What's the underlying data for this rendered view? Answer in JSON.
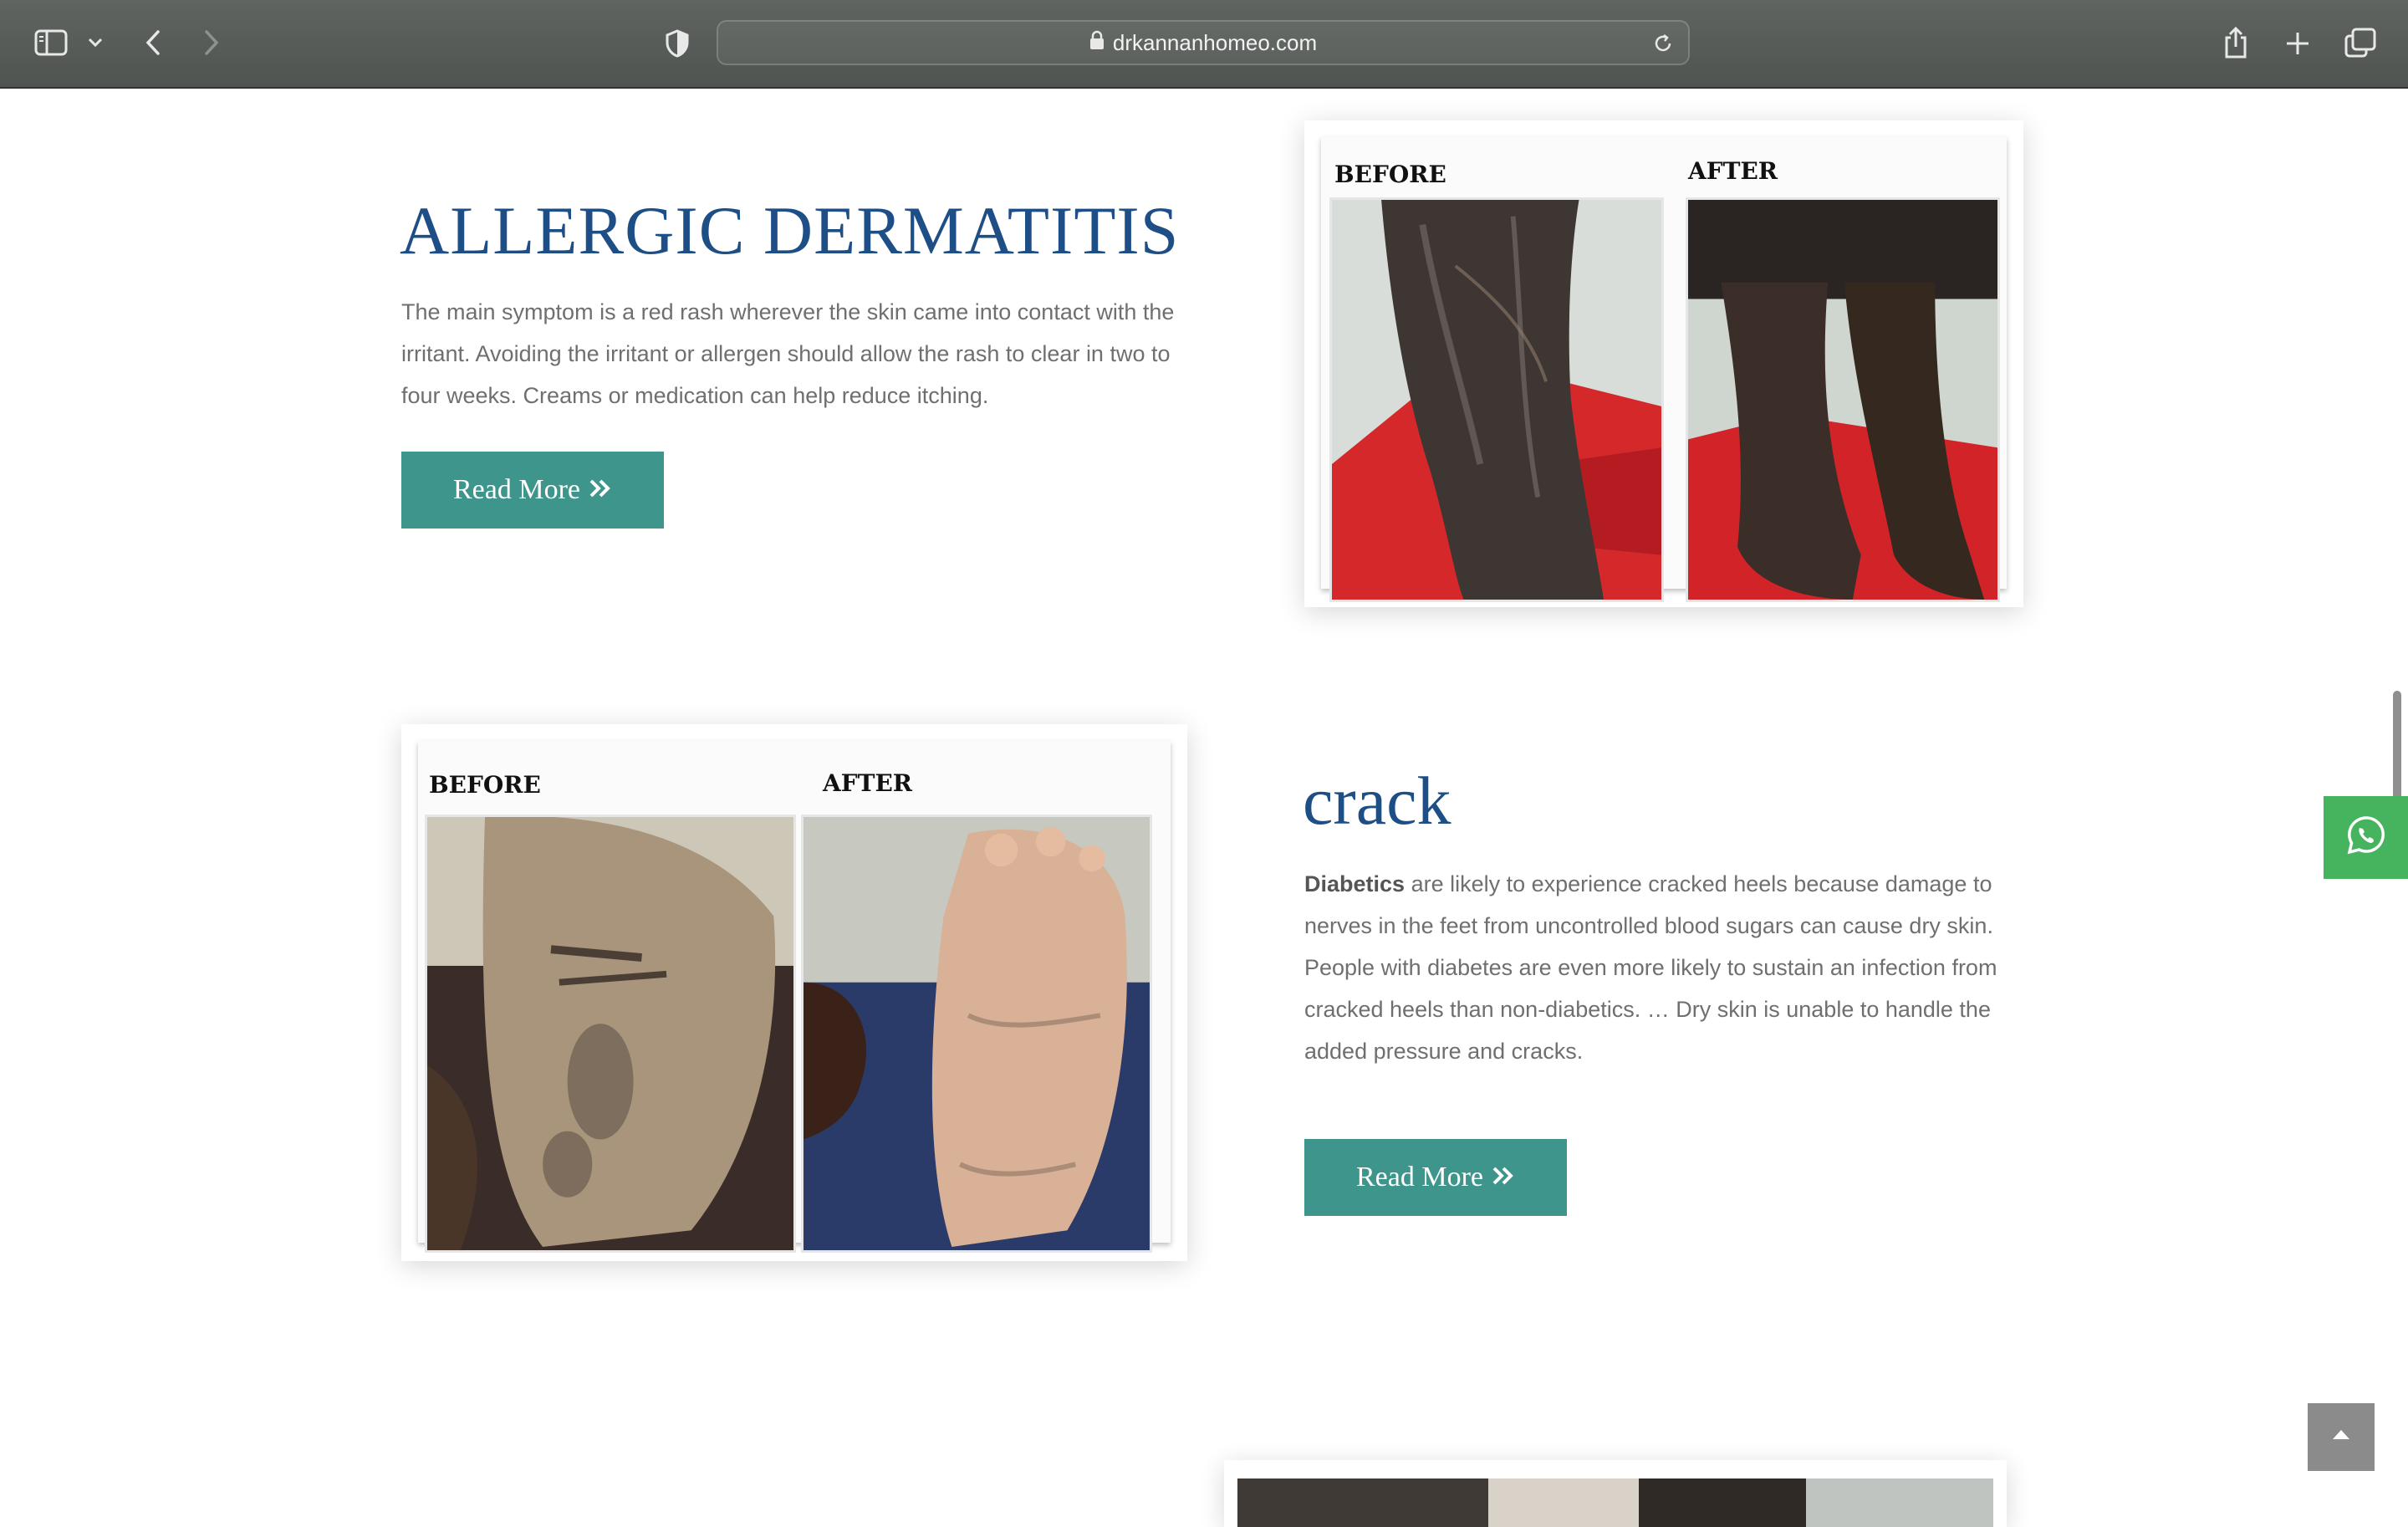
{
  "browser": {
    "url": "drkannanhomeo.com",
    "icons": [
      "sidebar-icon",
      "chevron-down-icon",
      "back-icon",
      "forward-icon",
      "shield-icon",
      "lock-icon",
      "reload-icon",
      "share-icon",
      "new-tab-icon",
      "tabs-overview-icon"
    ]
  },
  "sections": [
    {
      "title": "ALLERGIC DERMATITIS",
      "description": "The main symptom is a red rash wherever the skin came into contact with the irritant. Avoiding the irritant or allergen should allow the rash to clear in two to four weeks. Creams or medication can help reduce itching.",
      "button_label": "Read More",
      "image": {
        "before_label": "BEFORE",
        "after_label": "AFTER"
      }
    },
    {
      "title": "crack",
      "description_bold": "Diabetics",
      "description": " are likely to experience cracked heels because damage to nerves in the feet from uncontrolled blood sugars can cause dry skin. People with diabetes are even more likely to sustain an infection from cracked heels than non-diabetics. … Dry skin is unable to handle the added pressure and cracks.",
      "button_label": "Read More",
      "image": {
        "before_label": "BEFORE",
        "after_label": "AFTER"
      }
    }
  ],
  "floating": {
    "whatsapp_icon": "whatsapp-icon",
    "back_to_top_icon": "chevron-up-icon"
  },
  "colors": {
    "heading": "#1e4e86",
    "button": "#3e958b",
    "whatsapp": "#46b35f",
    "text": "#6f6f6f"
  }
}
